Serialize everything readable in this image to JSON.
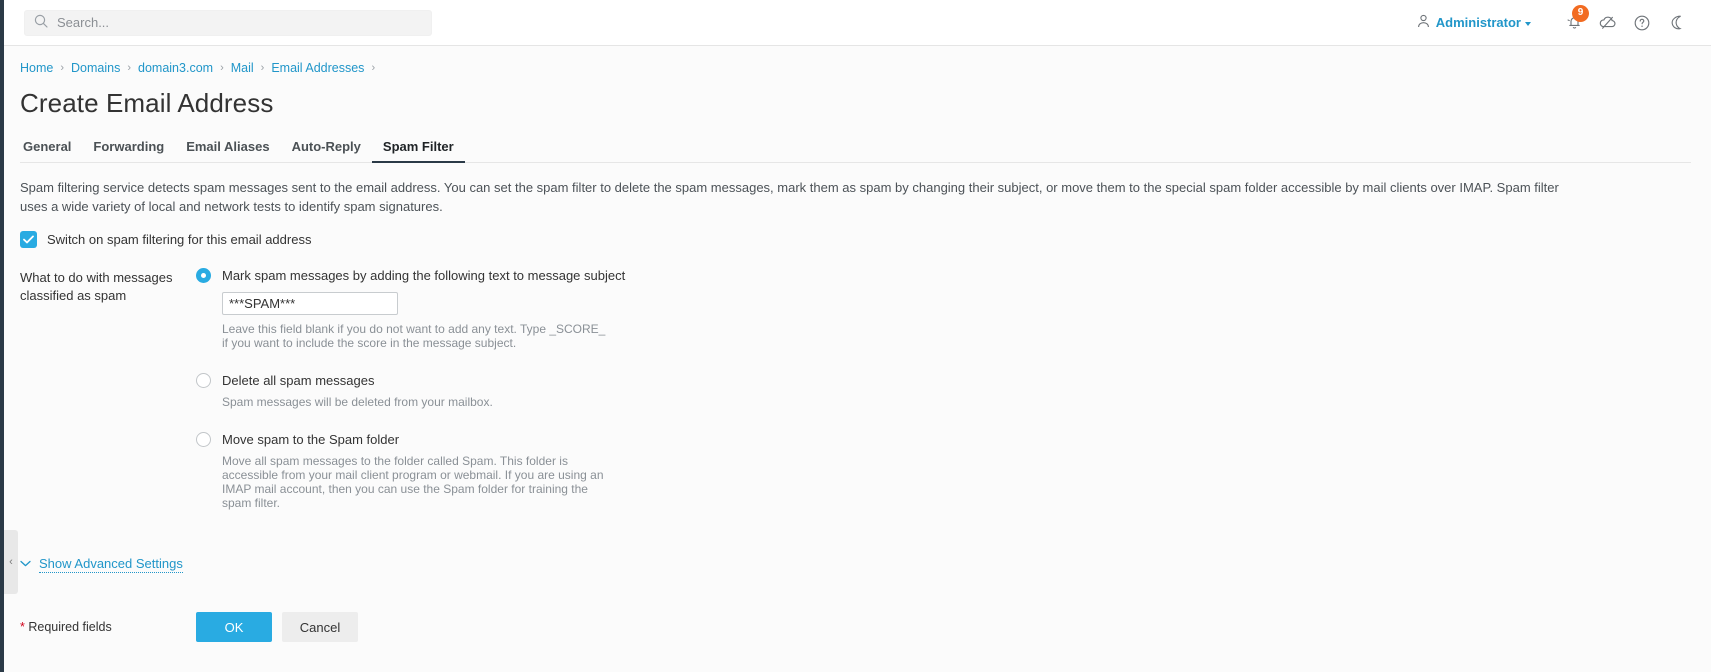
{
  "header": {
    "search": {
      "placeholder": "Search...",
      "icon": "search-icon"
    },
    "user": {
      "name": "Administrator",
      "icon": "user-icon",
      "caret": "chevron-down-icon"
    },
    "icons": [
      {
        "name": "notifications-bell-icon",
        "badge": "9"
      },
      {
        "name": "cloud-slash-icon",
        "badge": ""
      },
      {
        "name": "help-question-icon",
        "badge": ""
      },
      {
        "name": "dark-mode-moon-icon",
        "badge": ""
      }
    ]
  },
  "breadcrumb": {
    "items": [
      "Home",
      "Domains",
      "domain3.com",
      "Mail",
      "Email Addresses"
    ],
    "separator": "›"
  },
  "page": {
    "title": "Create Email Address"
  },
  "tabs": [
    {
      "label": "General",
      "active": false
    },
    {
      "label": "Forwarding",
      "active": false
    },
    {
      "label": "Email Aliases",
      "active": false
    },
    {
      "label": "Auto-Reply",
      "active": false
    },
    {
      "label": "Spam Filter",
      "active": true
    }
  ],
  "spam_filter": {
    "intro": "Spam filtering service detects spam messages sent to the email address. You can set the spam filter to delete the spam messages, mark them as spam by changing their subject, or move them to the special spam folder accessible by mail clients over IMAP. Spam filter uses a wide variety of local and network tests to identify spam signatures.",
    "switch_label": "Switch on spam filtering for this email address",
    "switch_checked": true,
    "field_label": "What to do with messages classified as spam",
    "options": [
      {
        "label": "Mark spam messages by adding the following text to message subject",
        "selected": true,
        "input_value": "***SPAM***",
        "input_placeholder": "",
        "hint": "Leave this field blank if you do not want to add any text. Type _SCORE_ if you want to include the score in the message subject."
      },
      {
        "label": "Delete all spam messages",
        "selected": false,
        "hint": "Spam messages will be deleted from your mailbox."
      },
      {
        "label": "Move spam to the Spam folder",
        "selected": false,
        "hint": "Move all spam messages to the folder called Spam. This folder is accessible from your mail client program or webmail. If you are using an IMAP mail account, then you can use the Spam folder for training the spam filter."
      }
    ],
    "advanced_link": "Show Advanced Settings",
    "advanced_chevron": "chevron-down-icon"
  },
  "footer": {
    "required_star": "*",
    "required_text": " Required fields",
    "ok_label": "OK",
    "cancel_label": "Cancel"
  },
  "rail": {
    "collapse_icon": "‹"
  },
  "colors": {
    "accent": "#29abe2",
    "link": "#2196c9",
    "badge": "#f26b21",
    "rail": "#2b3a47",
    "required": "#d0021b"
  }
}
